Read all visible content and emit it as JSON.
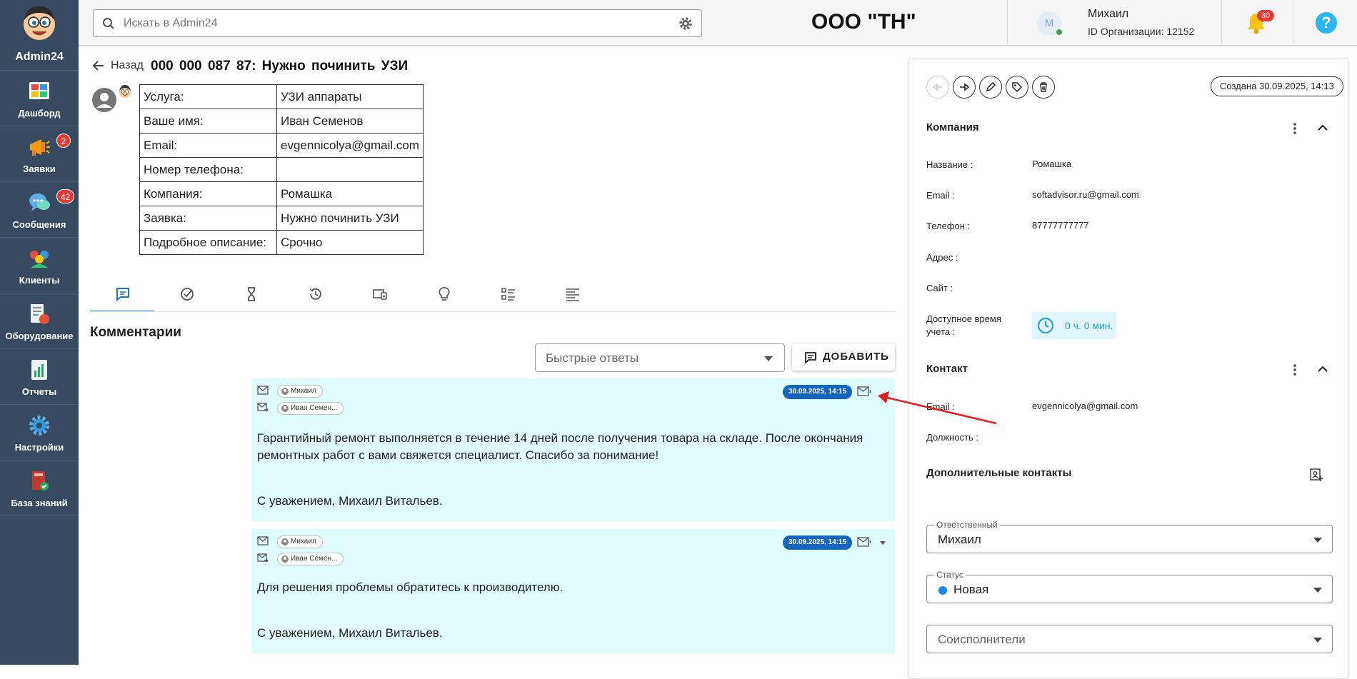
{
  "sidebar": {
    "logo_text": "Admin24",
    "items": [
      {
        "label": "Дашборд",
        "icon": "dashboard-icon",
        "badge": ""
      },
      {
        "label": "Заявки",
        "icon": "megaphone-icon",
        "badge": "2"
      },
      {
        "label": "Сообщения",
        "icon": "chat-bubbles-icon",
        "badge": "42"
      },
      {
        "label": "Клиенты",
        "icon": "clients-icon",
        "badge": ""
      },
      {
        "label": "Оборудование",
        "icon": "equipment-icon",
        "badge": ""
      },
      {
        "label": "Отчеты",
        "icon": "reports-icon",
        "badge": ""
      },
      {
        "label": "Настройки",
        "icon": "settings-gear-icon",
        "badge": ""
      },
      {
        "label": "База знаний",
        "icon": "knowledge-base-icon",
        "badge": ""
      }
    ]
  },
  "header": {
    "search_placeholder": "Искать в Admin24",
    "org_title": "ООО \"ТН\"",
    "avatar_letter": "М",
    "user_name": "Михаил",
    "org_id": "ID Организации: 12152",
    "notifications_count": "30",
    "help_glyph": "?"
  },
  "ticket": {
    "back_label": "Назад",
    "title": "000 000 087  87: Нужно починить УЗИ",
    "fields": [
      {
        "key": "Услуга:",
        "value": "УЗИ аппараты"
      },
      {
        "key": "Ваше имя:",
        "value": "Иван Семенов"
      },
      {
        "key": "Email:",
        "value": "evgennicolya@gmail.com"
      },
      {
        "key": "Номер телефона:",
        "value": ""
      },
      {
        "key": "Компания:",
        "value": "Ромашка"
      },
      {
        "key": "Заявка:",
        "value": "Нужно починить УЗИ"
      },
      {
        "key": "Подробное описание:",
        "value": "Срочно"
      }
    ]
  },
  "tabs": [
    {
      "icon": "comment-icon",
      "active": true
    },
    {
      "icon": "check-circle-icon",
      "active": false
    },
    {
      "icon": "hourglass-icon",
      "active": false
    },
    {
      "icon": "history-icon",
      "active": false
    },
    {
      "icon": "devices-icon",
      "active": false
    },
    {
      "icon": "lightbulb-icon",
      "active": false
    },
    {
      "icon": "checklist-icon",
      "active": false
    },
    {
      "icon": "text-lines-icon",
      "active": false
    }
  ],
  "comments": {
    "title": "Комментарии",
    "quick_replies_placeholder": "Быстрые ответы",
    "add_label": "ДОБАВИТЬ",
    "messages": [
      {
        "from": "Михаил",
        "to": "Иван Семен...",
        "date": "30.09.2025, 14:15",
        "body_lines": [
          "Гарантийный ремонт выполняется в течение 14 дней после получения товара на складе. После окончания",
          "ремонтных работ с вами свяжется специалист. Спасибо за понимание!",
          "",
          "",
          "С уважением, Михаил Витальев."
        ]
      },
      {
        "from": "Михаил",
        "to": "Иван Семен...",
        "date": "30.09.2025, 14:15",
        "body_lines": [
          "Для решения проблемы обратитесь к производителю.",
          "",
          "",
          "С уважением, Михаил Витальев."
        ]
      }
    ]
  },
  "right_panel": {
    "created": "Создана 30.09.2025, 14:13",
    "company": {
      "title": "Компания",
      "fields": [
        {
          "label": "Название :",
          "value": "Ромашка"
        },
        {
          "label": "Email :",
          "value": "softadvisor.ru@gmail.com"
        },
        {
          "label": "Телефон :",
          "value": "87777777777"
        },
        {
          "label": "Адрес :",
          "value": ""
        },
        {
          "label": "Сайт :",
          "value": ""
        }
      ],
      "time_label": "Доступное время учета :",
      "time_value": "0 ч. 0 мин."
    },
    "contact": {
      "title": "Контакт",
      "fields": [
        {
          "label": "Email :",
          "value": "evgennicolya@gmail.com"
        },
        {
          "label": "Должность :",
          "value": ""
        }
      ]
    },
    "additional_contacts_title": "Дополнительные контакты",
    "responsible": {
      "label": "Ответственный",
      "value": "Михаил"
    },
    "status": {
      "label": "Статус",
      "value": "Новая",
      "color": "#1e88e5"
    },
    "co_executors_placeholder": "Соисполнители"
  },
  "colors": {
    "sidebar_bg": "#384a5f",
    "accent": "#1976d2",
    "message_bg": "#e0fbfc",
    "badge_red": "#e53935",
    "date_badge": "#1565c0",
    "annotation_arrow": "#e01e1e"
  }
}
